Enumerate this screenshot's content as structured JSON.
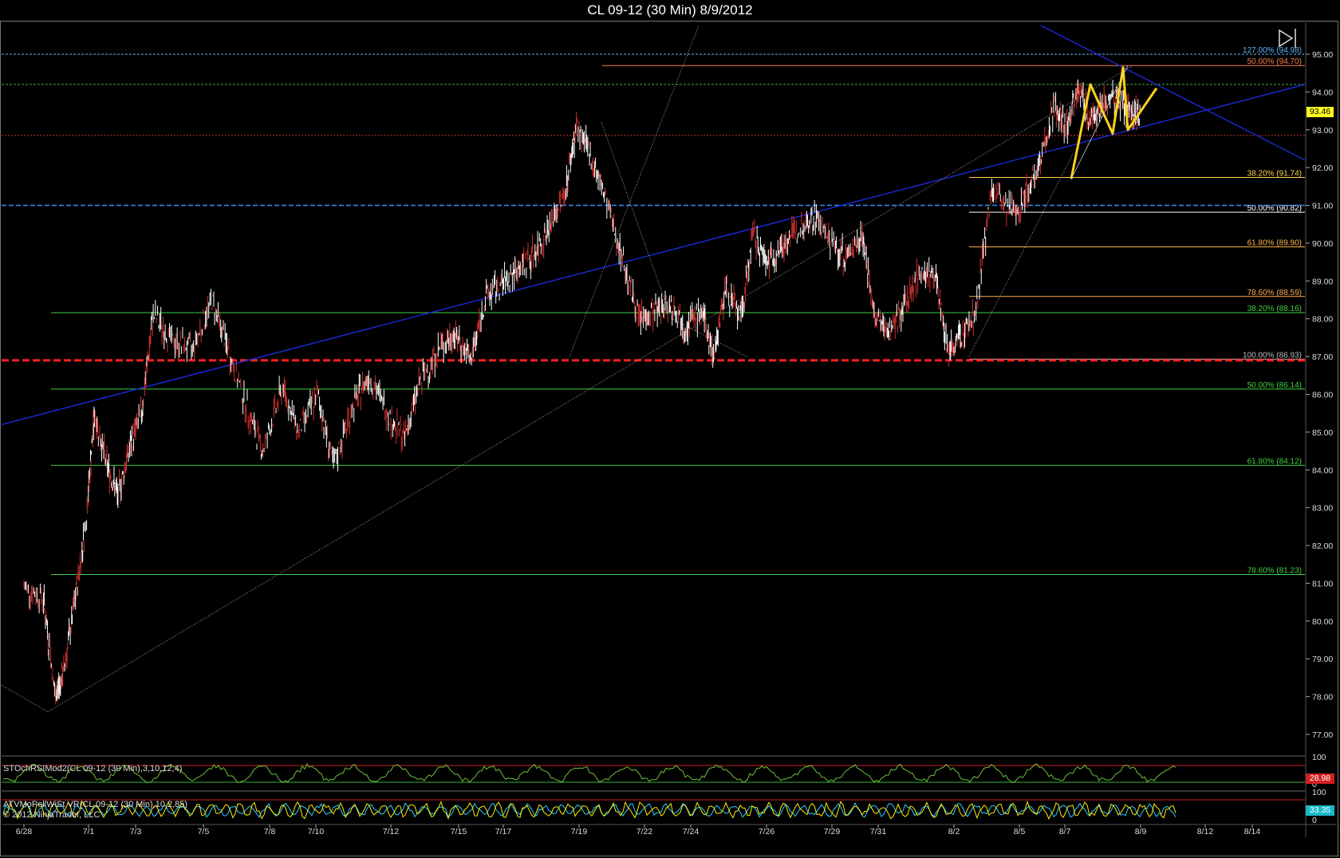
{
  "window": {
    "title": "CL 09-12 (30 Min)  8/9/2012"
  },
  "chart_data": {
    "type": "candlestick",
    "instrument": "CL 09-12",
    "interval": "30 Min",
    "ylim": [
      76.3,
      95.5
    ],
    "y_ticks": [
      77.0,
      78.0,
      79.0,
      80.0,
      81.0,
      82.0,
      83.0,
      84.0,
      85.0,
      86.0,
      87.0,
      88.0,
      89.0,
      90.0,
      91.0,
      92.0,
      93.0,
      94.0,
      95.0
    ],
    "x_ticks": [
      "6/28",
      "7/1",
      "7/3",
      "7/5",
      "7/8",
      "7/10",
      "7/12",
      "7/15",
      "7/17",
      "7/19",
      "7/22",
      "7/24",
      "7/26",
      "7/29",
      "7/31",
      "8/2",
      "8/5",
      "8/7",
      "8/9",
      "8/12",
      "8/14"
    ],
    "last_price": "93.46",
    "price_path": [
      {
        "d": 0.0,
        "p": 80.9
      },
      {
        "d": 0.5,
        "p": 80.6
      },
      {
        "d": 0.8,
        "p": 78.0
      },
      {
        "d": 1.0,
        "p": 78.6
      },
      {
        "d": 1.3,
        "p": 80.5
      },
      {
        "d": 1.6,
        "p": 82.8
      },
      {
        "d": 1.8,
        "p": 85.5
      },
      {
        "d": 2.1,
        "p": 84.2
      },
      {
        "d": 2.4,
        "p": 83.3
      },
      {
        "d": 2.7,
        "p": 84.6
      },
      {
        "d": 3.0,
        "p": 85.5
      },
      {
        "d": 3.3,
        "p": 88.1
      },
      {
        "d": 3.8,
        "p": 87.4
      },
      {
        "d": 4.3,
        "p": 87.2
      },
      {
        "d": 4.8,
        "p": 88.5
      },
      {
        "d": 5.2,
        "p": 87.2
      },
      {
        "d": 5.7,
        "p": 85.6
      },
      {
        "d": 6.1,
        "p": 84.5
      },
      {
        "d": 6.6,
        "p": 86.2
      },
      {
        "d": 7.0,
        "p": 85.0
      },
      {
        "d": 7.5,
        "p": 86.0
      },
      {
        "d": 7.9,
        "p": 84.1
      },
      {
        "d": 8.4,
        "p": 85.7
      },
      {
        "d": 8.8,
        "p": 86.5
      },
      {
        "d": 9.3,
        "p": 85.5
      },
      {
        "d": 9.7,
        "p": 84.8
      },
      {
        "d": 10.1,
        "p": 86.3
      },
      {
        "d": 10.6,
        "p": 87.2
      },
      {
        "d": 11.0,
        "p": 87.6
      },
      {
        "d": 11.4,
        "p": 86.9
      },
      {
        "d": 11.8,
        "p": 88.6
      },
      {
        "d": 12.2,
        "p": 88.9
      },
      {
        "d": 12.6,
        "p": 89.3
      },
      {
        "d": 13.0,
        "p": 89.7
      },
      {
        "d": 13.4,
        "p": 90.4
      },
      {
        "d": 13.8,
        "p": 91.3
      },
      {
        "d": 14.1,
        "p": 93.1
      },
      {
        "d": 14.5,
        "p": 92.2
      },
      {
        "d": 14.9,
        "p": 91.0
      },
      {
        "d": 15.3,
        "p": 89.5
      },
      {
        "d": 15.7,
        "p": 88.0
      },
      {
        "d": 16.1,
        "p": 88.2
      },
      {
        "d": 16.5,
        "p": 88.4
      },
      {
        "d": 16.9,
        "p": 87.8
      },
      {
        "d": 17.3,
        "p": 88.2
      },
      {
        "d": 17.6,
        "p": 87.0
      },
      {
        "d": 17.9,
        "p": 88.8
      },
      {
        "d": 18.3,
        "p": 88.0
      },
      {
        "d": 18.6,
        "p": 90.2
      },
      {
        "d": 19.0,
        "p": 89.5
      },
      {
        "d": 19.4,
        "p": 90.0
      },
      {
        "d": 19.8,
        "p": 90.4
      },
      {
        "d": 20.2,
        "p": 90.7
      },
      {
        "d": 20.6,
        "p": 90.0
      },
      {
        "d": 21.0,
        "p": 89.6
      },
      {
        "d": 21.4,
        "p": 90.3
      },
      {
        "d": 21.7,
        "p": 88.0
      },
      {
        "d": 22.1,
        "p": 87.7
      },
      {
        "d": 22.5,
        "p": 88.4
      },
      {
        "d": 22.9,
        "p": 89.3
      },
      {
        "d": 23.3,
        "p": 89.0
      },
      {
        "d": 23.6,
        "p": 87.1
      },
      {
        "d": 23.9,
        "p": 87.5
      },
      {
        "d": 24.3,
        "p": 88.2
      },
      {
        "d": 24.7,
        "p": 91.5
      },
      {
        "d": 25.1,
        "p": 90.8
      },
      {
        "d": 25.5,
        "p": 91.1
      },
      {
        "d": 25.9,
        "p": 92.1
      },
      {
        "d": 26.3,
        "p": 93.6
      },
      {
        "d": 26.6,
        "p": 93.0
      },
      {
        "d": 26.9,
        "p": 94.2
      },
      {
        "d": 27.2,
        "p": 93.2
      },
      {
        "d": 27.5,
        "p": 93.7
      },
      {
        "d": 27.9,
        "p": 93.9
      },
      {
        "d": 28.2,
        "p": 93.4
      },
      {
        "d": 28.5,
        "p": 93.5
      }
    ],
    "horizontal_levels": [
      {
        "label": "127.00% (94.98)",
        "y": 95.0,
        "color": "#5fb8ff",
        "dash": "3,2"
      },
      {
        "label": "50.00% (94.70)",
        "y": 94.7,
        "color": "#ff7a4a",
        "dash": ""
      },
      {
        "label": "",
        "y": 94.2,
        "color": "#4caf50",
        "dash": "3,2"
      },
      {
        "label": "",
        "y": 92.85,
        "color": "#d03030",
        "dash": "2,2"
      },
      {
        "label": "38.20% (91.74)",
        "y": 91.74,
        "color": "#ffd24a",
        "dash": ""
      },
      {
        "label": "50.00% (90.82)",
        "y": 90.82,
        "color": "#ffffff",
        "dash": ""
      },
      {
        "label": "61.80% (89.90)",
        "y": 89.9,
        "color": "#ffb347",
        "dash": ""
      },
      {
        "label": "78.60% (88.59)",
        "y": 88.59,
        "color": "#ffa94d",
        "dash": ""
      },
      {
        "label": "38.20% (88.16)",
        "y": 88.16,
        "color": "#3fd23f",
        "dash": ""
      },
      {
        "label": "100.00% (86.93)",
        "y": 86.93,
        "color": "#bbbbbb",
        "dash": ""
      },
      {
        "label": "50.00% (86.14)",
        "y": 86.14,
        "color": "#3fd23f",
        "dash": ""
      },
      {
        "label": "61.80% (84.12)",
        "y": 84.12,
        "color": "#3fd23f",
        "dash": ""
      },
      {
        "label": "78.60% (81.23)",
        "y": 81.23,
        "color": "#3fd23f",
        "dash": ""
      }
    ],
    "colors": {
      "up": "#ffffff",
      "down": "#d03030",
      "trendline": "#1a2ad8",
      "pattern": "#ffd21a",
      "support": "#ff2020",
      "indicator1": "#6cc23a",
      "indicator2": "#ffee00",
      "indicator2b": "#2bd0ff"
    }
  },
  "indicators": {
    "stoch": {
      "label": "STOchRSIMod2(CL 09-12 (30 Min),3,10,12,4)",
      "value": "28.98"
    },
    "wave": {
      "label": "ATVMoPellWiSt VR(CL 09-12 (30 Min),10,2,85)",
      "value": "33.35"
    },
    "copyright": "© 2012 NinjaTrader, LLC"
  },
  "controls": {
    "replay_icon": "play-pause-icon"
  }
}
